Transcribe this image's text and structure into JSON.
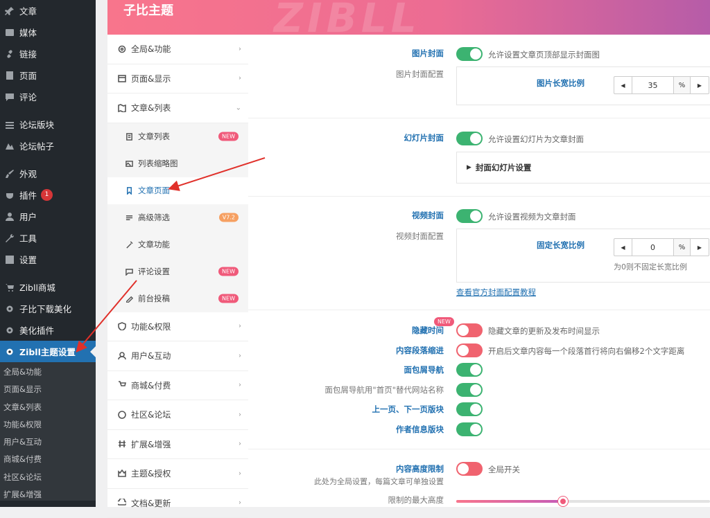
{
  "wp_menu": {
    "items": [
      {
        "label": "文章",
        "icon": "pin-icon"
      },
      {
        "label": "媒体",
        "icon": "media-icon"
      },
      {
        "label": "链接",
        "icon": "link-icon"
      },
      {
        "label": "页面",
        "icon": "page-icon"
      },
      {
        "label": "评论",
        "icon": "comment-icon"
      },
      {
        "label": "论坛版块",
        "icon": "forum-icon"
      },
      {
        "label": "论坛帖子",
        "icon": "post-icon"
      },
      {
        "label": "外观",
        "icon": "brush-icon"
      },
      {
        "label": "插件",
        "icon": "plugin-icon",
        "badge": "1"
      },
      {
        "label": "用户",
        "icon": "user-icon"
      },
      {
        "label": "工具",
        "icon": "wrench-icon"
      },
      {
        "label": "设置",
        "icon": "settings-icon"
      },
      {
        "label": "Zibll商城",
        "icon": "cart-icon"
      },
      {
        "label": "子比下载美化",
        "icon": "gear-icon"
      },
      {
        "label": "美化插件",
        "icon": "gear-icon"
      },
      {
        "label": "Zibll主题设置",
        "icon": "gear-icon"
      }
    ],
    "submenu": [
      "全局&功能",
      "页面&显示",
      "文章&列表",
      "功能&权限",
      "用户&互动",
      "商城&付费",
      "社区&论坛",
      "扩展&增强"
    ]
  },
  "header": {
    "title": "子比主题",
    "watermark": "ZIBLL"
  },
  "nav": {
    "top": [
      {
        "label": "全局&功能",
        "chev": "›"
      },
      {
        "label": "页面&显示",
        "chev": "›"
      },
      {
        "label": "文章&列表",
        "chev": "⌄"
      }
    ],
    "sub": [
      {
        "label": "文章列表",
        "tag": "NEW"
      },
      {
        "label": "列表缩略图",
        "tag": ""
      },
      {
        "label": "文章页面",
        "tag": ""
      },
      {
        "label": "高级筛选",
        "tag": "V7.2"
      },
      {
        "label": "文章功能",
        "tag": ""
      },
      {
        "label": "评论设置",
        "tag": "NEW"
      },
      {
        "label": "前台投稿",
        "tag": "NEW"
      }
    ],
    "bottom": [
      {
        "label": "功能&权限",
        "chev": "›"
      },
      {
        "label": "用户&互动",
        "chev": "›"
      },
      {
        "label": "商城&付费",
        "chev": "›"
      },
      {
        "label": "社区&论坛",
        "chev": "›"
      },
      {
        "label": "扩展&增强",
        "chev": "›"
      },
      {
        "label": "主题&授权",
        "chev": "›"
      },
      {
        "label": "文档&更新",
        "chev": "›"
      }
    ]
  },
  "content": {
    "image_cover": {
      "label": "图片封面",
      "desc": "允许设置文章页顶部显示封面图",
      "config_label": "图片封面配置",
      "ratio_label": "图片长宽比例",
      "ratio_value": "35",
      "unit": "%"
    },
    "slide_cover": {
      "label": "幻灯片封面",
      "desc": "允许设置幻灯片为文章封面",
      "collapse_label": "封面幻灯片设置"
    },
    "video_cover": {
      "label": "视频封面",
      "desc": "允许设置视频为文章封面",
      "config_label": "视频封面配置",
      "ratio_label": "固定长宽比例",
      "ratio_value": "0",
      "unit": "%",
      "ratio_hint": "为0则不固定长宽比例",
      "link": "查看官方封面配置教程"
    },
    "toggles": [
      {
        "label": "隐藏时间",
        "desc": "隐藏文章的更新及发布时间显示",
        "on": false,
        "new": "NEW"
      },
      {
        "label": "内容段落缩进",
        "desc": "开启后文章内容每一个段落首行将向右偏移2个文字距离",
        "on": false
      },
      {
        "label": "面包屑导航",
        "desc": "",
        "on": true
      },
      {
        "label": "面包屑导航用\"首页\"替代网站名称",
        "desc": "",
        "on": true,
        "grey": true
      },
      {
        "label": "上一页、下一页版块",
        "desc": "",
        "on": true
      },
      {
        "label": "作者信息版块",
        "desc": "",
        "on": true
      }
    ],
    "height_limit": {
      "label": "内容高度限制",
      "sub": "此处为全局设置，每篇文章可单独设置",
      "desc": "全局开关",
      "max_label": "限制的最大高度",
      "slider_fraction": 0.42
    }
  },
  "colors": {
    "accent": "#2271b1",
    "toggle_on": "#3cb371",
    "toggle_off": "#f0636f",
    "arrow": "#e0302a"
  }
}
